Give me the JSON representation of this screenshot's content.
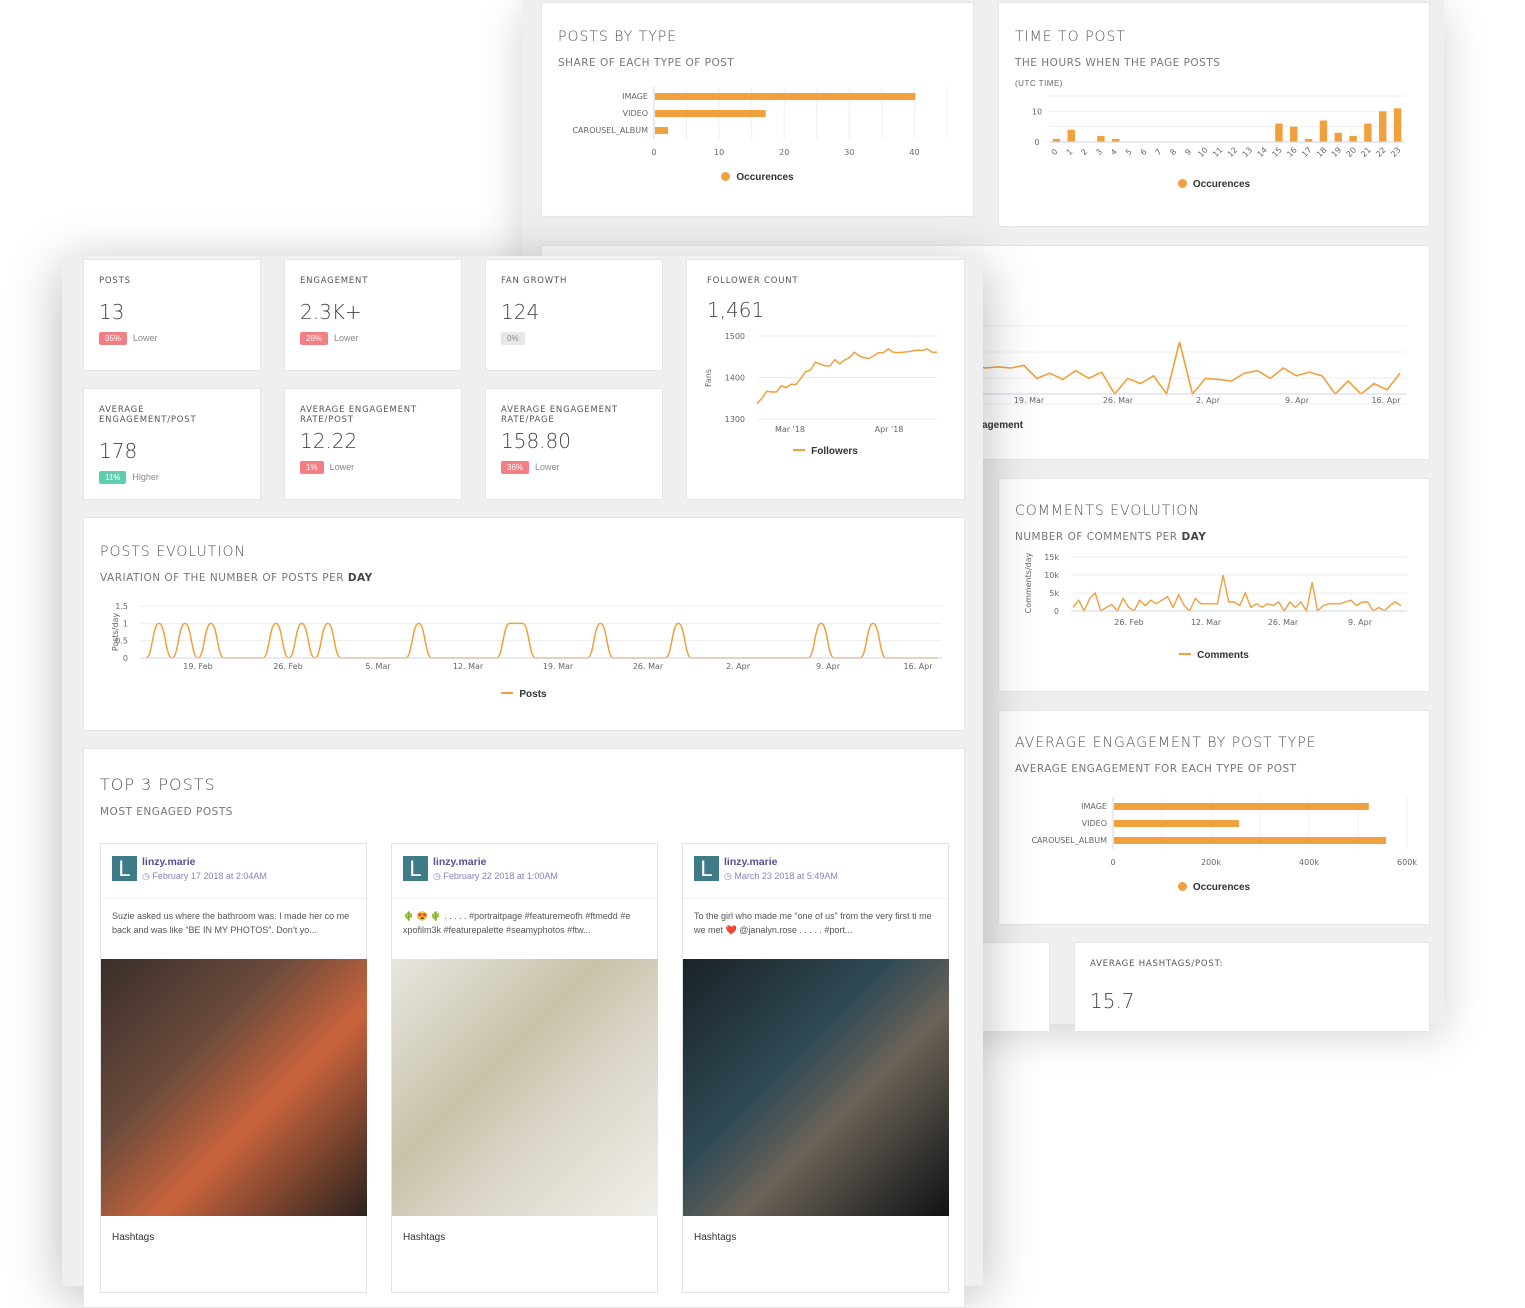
{
  "posts_by_type": {
    "title": "POSTS BY TYPE",
    "subtitle": "SHARE OF EACH TYPE OF POST",
    "legend": "Occurences",
    "chart_data": {
      "type": "bar",
      "orientation": "horizontal",
      "categories": [
        "IMAGE",
        "VIDEO",
        "CAROUSEL_ALBUM"
      ],
      "values": [
        40,
        17,
        2
      ],
      "xlim": [
        0,
        45
      ],
      "xticks": [
        "0",
        "10",
        "20",
        "30",
        "40"
      ],
      "series_name": "Occurences"
    }
  },
  "time_to_post": {
    "title": "TIME TO POST",
    "subtitle": "THE HOURS WHEN THE PAGE POSTS",
    "note": "(UTC TIME)",
    "legend": "Occurences",
    "chart_data": {
      "type": "bar",
      "categories": [
        "0",
        "1",
        "2",
        "3",
        "4",
        "5",
        "6",
        "7",
        "8",
        "9",
        "10",
        "11",
        "12",
        "13",
        "14",
        "15",
        "16",
        "17",
        "18",
        "19",
        "20",
        "21",
        "22",
        "23"
      ],
      "values": [
        1,
        4,
        0,
        2,
        1,
        0,
        0,
        0,
        0,
        0,
        0,
        0,
        0,
        0,
        0,
        6,
        5,
        1,
        7,
        3,
        2,
        6,
        10,
        11
      ],
      "ylim": [
        0,
        15
      ],
      "yticks": [
        "0",
        "10"
      ],
      "series_name": "Occurences"
    }
  },
  "engagement_evolution": {
    "legend_partial": "agement",
    "chart_data": {
      "type": "line",
      "x": [
        "19. Mar",
        "26. Mar",
        "2. Apr",
        "9. Apr",
        "16. Apr"
      ],
      "values": [
        0.55,
        0.5,
        0.52,
        0.5,
        0.55,
        0.3,
        0.4,
        0.28,
        0.45,
        0.3,
        0.42,
        0.0,
        0.3,
        0.2,
        0.35,
        0.0,
        1.0,
        0.0,
        0.3,
        0.28,
        0.25,
        0.4,
        0.45,
        0.3,
        0.5,
        0.35,
        0.42,
        0.35,
        0.0,
        0.25,
        0.0,
        0.2,
        0.08,
        0.4
      ]
    }
  },
  "kpis": [
    {
      "label": "POSTS",
      "value": "13",
      "delta": "35%",
      "trend": "Lower",
      "status": "bad"
    },
    {
      "label": "ENGAGEMENT",
      "value": "2.3K+",
      "delta": "28%",
      "trend": "Lower",
      "status": "bad"
    },
    {
      "label": "FAN GROWTH",
      "value": "124",
      "delta": "0%",
      "trend": "",
      "status": "neutral"
    },
    {
      "label": "AVERAGE ENGAGEMENT/POST",
      "value": "178",
      "delta": "11%",
      "trend": "Higher",
      "status": "good"
    },
    {
      "label": "AVERAGE ENGAGEMENT RATE/POST",
      "value": "12.22",
      "delta": "1%",
      "trend": "Lower",
      "status": "bad"
    },
    {
      "label": "AVERAGE ENGAGEMENT RATE/PAGE",
      "value": "158.80",
      "delta": "36%",
      "trend": "Lower",
      "status": "bad"
    }
  ],
  "follower_count": {
    "label": "FOLLOWER COUNT",
    "value": "1,461",
    "legend": "Followers",
    "chart_data": {
      "type": "line",
      "ylabel": "Fans",
      "ylim": [
        1300,
        1500
      ],
      "yticks": [
        "1300",
        "1400",
        "1500"
      ],
      "xticks": [
        "Mar '18",
        "Apr '18"
      ],
      "values": [
        1337,
        1350,
        1367,
        1365,
        1365,
        1380,
        1376,
        1384,
        1383,
        1398,
        1414,
        1418,
        1437,
        1432,
        1428,
        1428,
        1443,
        1433,
        1442,
        1448,
        1461,
        1452,
        1448,
        1446,
        1452,
        1460,
        1460,
        1469,
        1461,
        1460,
        1461,
        1462,
        1464,
        1466,
        1465,
        1469,
        1461,
        1461
      ]
    }
  },
  "posts_evolution": {
    "title": "POSTS EVOLUTION",
    "subtitle_prefix": "VARIATION OF THE NUMBER OF POSTS PER ",
    "subtitle_bold": "DAY",
    "legend": "Posts",
    "chart_data": {
      "type": "line",
      "ylabel": "Posts/day",
      "ylim": [
        0,
        1.5
      ],
      "yticks": [
        "0",
        "0.5",
        "1",
        "1.5"
      ],
      "xticks": [
        "19. Feb",
        "26. Feb",
        "5. Mar",
        "12. Mar",
        "19. Mar",
        "26. Mar",
        "2. Apr",
        "9. Apr",
        "16. Apr"
      ],
      "start_day": "16. Feb",
      "end_day": "17. Apr",
      "post_days": [
        1,
        3,
        5,
        10,
        12,
        14,
        21,
        28,
        29,
        35,
        41,
        52,
        56
      ]
    }
  },
  "comments_evolution": {
    "title": "COMMENTS EVOLUTION",
    "subtitle_prefix": "NUMBER OF COMMENTS PER ",
    "subtitle_bold": "DAY",
    "legend": "Comments",
    "chart_data": {
      "type": "line",
      "ylabel": "Comments/day",
      "ylim": [
        0,
        15000
      ],
      "yticks": [
        "0",
        "5k",
        "10k",
        "15k"
      ],
      "xticks": [
        "26. Feb",
        "12. Mar",
        "26. Mar",
        "9. Apr"
      ],
      "values": [
        1000,
        3000,
        0,
        3500,
        5000,
        0,
        1000,
        1800,
        0,
        3500,
        1000,
        0,
        3000,
        1500,
        3000,
        2000,
        3000,
        4000,
        1000,
        4500,
        1500,
        0,
        3500,
        2000,
        2000,
        2000,
        2000,
        10000,
        2500,
        2500,
        1500,
        5000,
        1000,
        2000,
        1000,
        2000,
        1500,
        2500,
        0,
        2500,
        1000,
        2500,
        0,
        8000,
        0,
        1500,
        2000,
        2000,
        2000,
        2500,
        3000,
        1500,
        2500,
        2500,
        0,
        1000,
        0,
        1500,
        2500,
        1500
      ]
    }
  },
  "avg_engagement_by_type": {
    "title": "AVERAGE ENGAGEMENT BY POST TYPE",
    "subtitle": "AVERAGE ENGAGEMENT FOR EACH TYPE OF POST",
    "legend": "Occurences",
    "chart_data": {
      "type": "bar",
      "orientation": "horizontal",
      "categories": [
        "IMAGE",
        "VIDEO",
        "CAROUSEL_ALBUM"
      ],
      "values": [
        520000,
        255000,
        555000
      ],
      "xlim": [
        0,
        600000
      ],
      "xticks": [
        "0",
        "200k",
        "400k",
        "600k"
      ],
      "series_name": "Occurences"
    }
  },
  "avg_hashtags": {
    "label": "AVERAGE HASHTAGS/POST:",
    "value": "15.7"
  },
  "top_posts": {
    "title": "TOP 3 POSTS",
    "subtitle": "MOST ENGAGED POSTS",
    "posts": [
      {
        "avatar": "L",
        "user": "linzy.marie",
        "date": "February 17 2018 at 2:04AM",
        "text": "Suzie asked us where the bathroom was. I made her co me back and was like “BE IN MY PHOTOS”. Don’t yo...",
        "hashtags_label": "Hashtags"
      },
      {
        "avatar": "L",
        "user": "linzy.marie",
        "date": "February 22 2018 at 1:00AM",
        "text": "🌵 😍 🌵 . . . . . #portraitpage #featuremeofh #ftmedd #e xpofilm3k #featurepalette #seamyphotos #ftw...",
        "hashtags_label": "Hashtags"
      },
      {
        "avatar": "L",
        "user": "linzy.marie",
        "date": "March 23 2018 at 5:49AM",
        "text": "To the girl who made me “one of us” from the very first ti me we met ❤️ @janalyn.rose . . . . . #port...",
        "hashtags_label": "Hashtags"
      }
    ]
  },
  "colors": {
    "accent": "#f0a03c",
    "bad": "#f17f84",
    "good": "#5fcdaf",
    "avatar": "#3f7a89",
    "username": "#5a4e9a"
  }
}
